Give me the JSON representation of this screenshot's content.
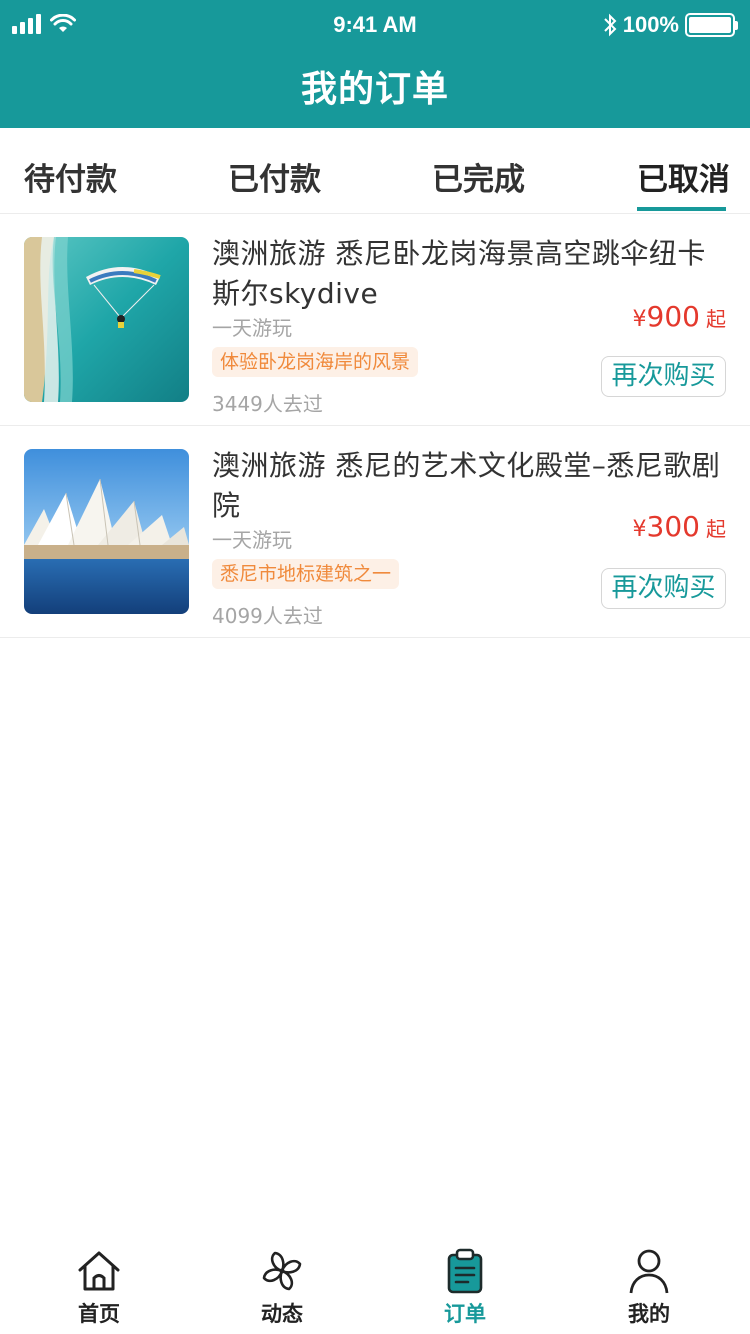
{
  "status_bar": {
    "time": "9:41 AM",
    "battery": "100%"
  },
  "header": {
    "title": "我的订单"
  },
  "tabs": [
    {
      "label": "待付款"
    },
    {
      "label": "已付款"
    },
    {
      "label": "已完成"
    },
    {
      "label": "已取消"
    }
  ],
  "active_tab": "已取消",
  "orders": [
    {
      "title": "澳洲旅游 悉尼卧龙岗海景高空跳伞纽卡斯尔skydive",
      "subtitle": "一天游玩",
      "tag": "体验卧龙岗海岸的风景",
      "count": "3449人去过",
      "currency": "¥",
      "price": "900",
      "price_unit": "起",
      "action": "再次购买",
      "image": "skydive-over-coast-photo"
    },
    {
      "title": "澳洲旅游 悉尼的艺术文化殿堂–悉尼歌剧院",
      "subtitle": "一天游玩",
      "tag": "悉尼市地标建筑之一",
      "count": "4099人去过",
      "currency": "¥",
      "price": "300",
      "price_unit": "起",
      "action": "再次购买",
      "image": "sydney-opera-house-photo"
    }
  ],
  "tabbar": [
    {
      "label": "首页",
      "icon": "home-icon"
    },
    {
      "label": "动态",
      "icon": "pinwheel-icon"
    },
    {
      "label": "订单",
      "icon": "clipboard-icon"
    },
    {
      "label": "我的",
      "icon": "user-icon"
    }
  ],
  "colors": {
    "primary": "#17999a",
    "price": "#e4392d",
    "tag_text": "#f08a3c",
    "tag_bg": "#fdf0e6"
  }
}
